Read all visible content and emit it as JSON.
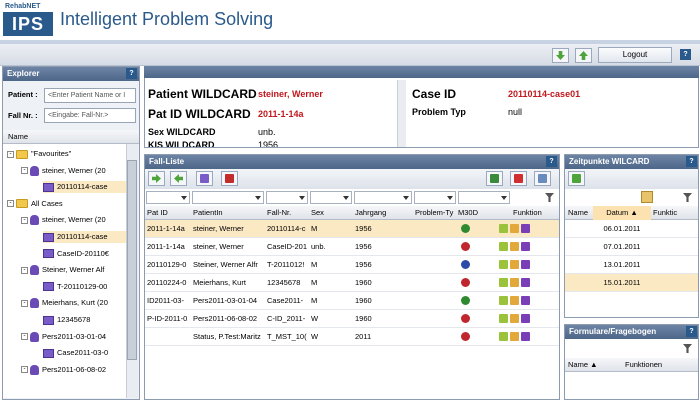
{
  "header": {
    "brand_small": "RehabNET",
    "brand_logo": "IPS",
    "title": "Intelligent Problem Solving"
  },
  "toolbar": {
    "logout_label": "Logout",
    "help_label": "?"
  },
  "explorer": {
    "title": "Explorer",
    "patient_label": "Patient :",
    "patient_placeholder": "<Enter Patient Name or I",
    "fall_label": "Fall Nr. :",
    "fall_placeholder": "<Eingabe: Fall-Nr.>",
    "col_name": "Name",
    "tree": [
      {
        "label": "\"Favourites\"",
        "type": "folder",
        "toggle": "-"
      },
      {
        "label": "steiner, Werner (20",
        "type": "person",
        "toggle": "-"
      },
      {
        "label": "20110114-case",
        "type": "case"
      },
      {
        "label": "All Cases",
        "type": "folder",
        "toggle": "-"
      },
      {
        "label": "steiner, Werner (20",
        "type": "person",
        "toggle": "-"
      },
      {
        "label": "20110114-case",
        "type": "case"
      },
      {
        "label": "CaseID-20110€",
        "type": "case"
      },
      {
        "label": "Steiner, Werner Alf",
        "type": "person",
        "toggle": "-"
      },
      {
        "label": "T-20110129-00",
        "type": "case"
      },
      {
        "label": "Meierhans, Kurt (20",
        "type": "person",
        "toggle": "-"
      },
      {
        "label": "12345678",
        "type": "case"
      },
      {
        "label": "Pers2011-03-01-04",
        "type": "person",
        "toggle": "-"
      },
      {
        "label": "Case2011-03-0",
        "type": "case"
      },
      {
        "label": "Pers2011-06-08-02",
        "type": "person",
        "toggle": "-"
      }
    ]
  },
  "patient_info": {
    "name_label": "Patient WILDCARD",
    "name_value": "steiner, Werner",
    "patid_label": "Pat ID WILDCARD",
    "patid_value": "2011-1-14a",
    "sex_label": "Sex WILDCARD",
    "sex_value": "unb.",
    "extra_label": "KIS WILDCARD",
    "extra_value": "1956",
    "caseid_label": "Case ID",
    "caseid_value": "20110114-case01",
    "problem_label": "Problem Typ",
    "problem_value": "null"
  },
  "fall_liste": {
    "title": "Fall-Liste",
    "columns": [
      "Pat ID",
      "PatientIn",
      "Fall-Nr.",
      "Sex",
      "Jahrgang",
      "Problem-Ty",
      "M30D",
      "Funktion"
    ],
    "rows": [
      [
        "2011-1-14a",
        "steiner, Werner",
        "20110114-c",
        "M",
        "1956",
        "",
        "green"
      ],
      [
        "2011-1-14a",
        "steiner, Werner",
        "CaseID-201",
        "unb.",
        "1956",
        "",
        "red"
      ],
      [
        "20110129-0",
        "Steiner, Werner Alfr",
        "T-2011012!",
        "M",
        "1956",
        "",
        "blue"
      ],
      [
        "20110224-0",
        "Meierhans, Kurt",
        "12345678",
        "M",
        "1960",
        "",
        "red"
      ],
      [
        "ID2011-03-",
        "Pers2011-03-01-04",
        "Case2011-",
        "M",
        "1960",
        "",
        "green"
      ],
      [
        "P-ID-2011-0",
        "Pers2011-06-08-02",
        "C-ID_2011-",
        "W",
        "1960",
        "",
        "red"
      ],
      [
        "",
        "Status, P.Test:Maritz",
        "T_MST_10(",
        "W",
        "2011",
        "",
        "red"
      ]
    ]
  },
  "zeitpunkte": {
    "title": "Zeitpunkte WILCARD",
    "columns": [
      "Name",
      "Datum",
      "Funktic"
    ],
    "sort_indicator": "▲",
    "rows": [
      "06.01.2011",
      "07.01.2011",
      "13.01.2011",
      "15.01.2011"
    ]
  },
  "formulare": {
    "title": "Formulare/Fragebogen",
    "columns": [
      "Name",
      "Funktionen"
    ],
    "sort_indicator": "▲"
  }
}
